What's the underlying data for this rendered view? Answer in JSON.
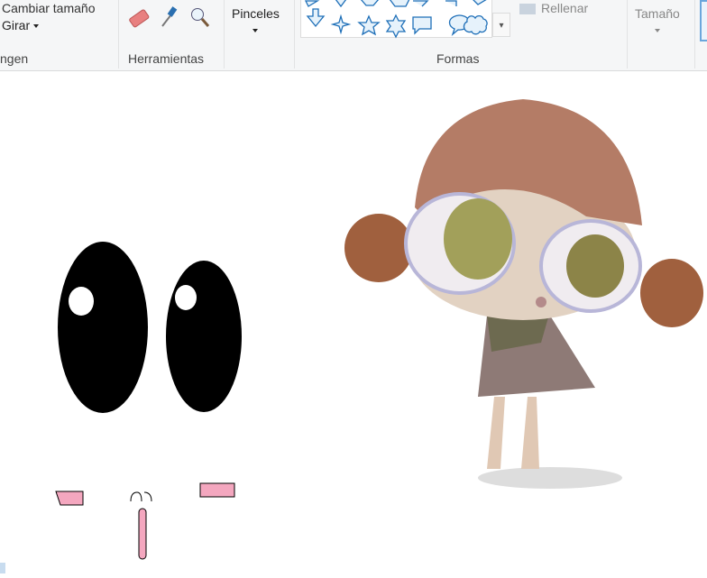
{
  "ribbon": {
    "image_group": {
      "resize_label": "Cambiar tamaño",
      "rotate_label": "Girar",
      "label": "ngen"
    },
    "tools_group": {
      "label": "Herramientas",
      "tools": [
        "eraser-icon",
        "color-picker-icon",
        "magnifier-icon"
      ]
    },
    "brushes_label": "Pinceles",
    "shapes_group": {
      "label": "Formas",
      "fill_label": "Rellenar"
    },
    "size_label": "Tamaño"
  },
  "colors": {
    "accent": "#1e6fb8",
    "ribbon_bg": "#f5f6f7"
  }
}
